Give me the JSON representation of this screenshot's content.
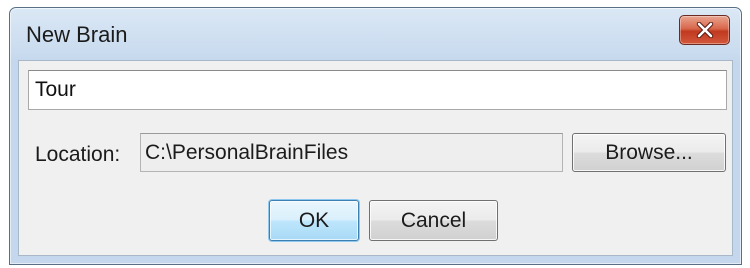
{
  "window": {
    "title": "New Brain"
  },
  "form": {
    "name_value": "Tour",
    "location_label": "Location:",
    "location_value": "C:\\PersonalBrainFiles"
  },
  "buttons": {
    "browse": "Browse...",
    "ok": "OK",
    "cancel": "Cancel"
  },
  "icons": {
    "close": "close-icon"
  },
  "colors": {
    "titlebar": "#c9dbef",
    "close_button": "#c7442b",
    "ok_button_border": "#3c7fb1"
  }
}
